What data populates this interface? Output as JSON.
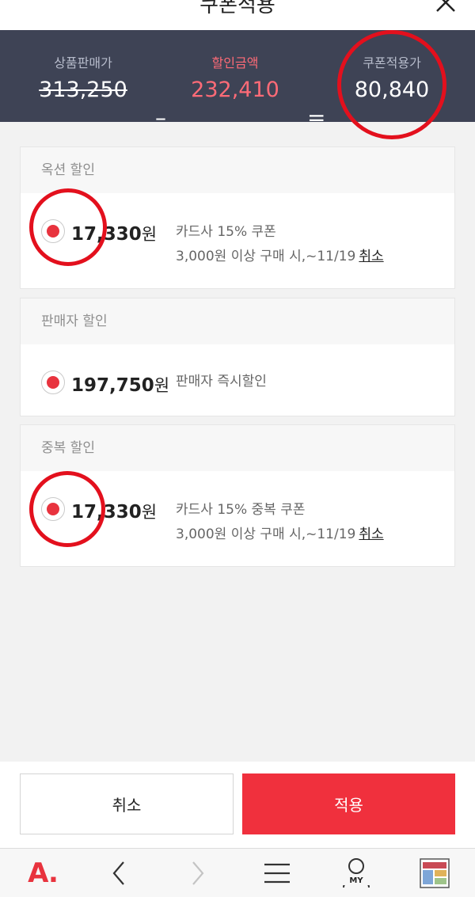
{
  "header": {
    "title": "쿠폰적용"
  },
  "summary": {
    "price_label": "상품판매가",
    "price_value": "313,250",
    "discount_label": "할인금액",
    "discount_value": "232,410",
    "final_label": "쿠폰적용가",
    "final_value": "80,840",
    "minus": "–",
    "equals": "="
  },
  "sections": [
    {
      "title": "옥션 할인",
      "amount": "17,330",
      "won": "원",
      "desc_line1": "카드사 15% 쿠폰",
      "desc_line2": "3,000원 이상 구매 시,~11/19",
      "cancel": "취소"
    },
    {
      "title": "판매자 할인",
      "amount": "197,750",
      "won": "원",
      "desc_line1": "판매자 즉시할인"
    },
    {
      "title": "중복 할인",
      "amount": "17,330",
      "won": "원",
      "desc_line1": "카드사 15% 중복 쿠폰",
      "desc_line2": "3,000원 이상 구매 시,~11/19",
      "cancel": "취소"
    }
  ],
  "buttons": {
    "cancel": "취소",
    "apply": "적용"
  },
  "nav": {
    "logo": "A.",
    "my_label": "MY"
  },
  "colors": {
    "accent": "#f0303d",
    "summary_bg": "#3e4355",
    "discount": "#ff6b77"
  },
  "icons": [
    "close-icon",
    "radio-selected-icon",
    "back-icon",
    "forward-icon",
    "menu-icon",
    "my-page-icon",
    "recent-item-thumbnail"
  ]
}
